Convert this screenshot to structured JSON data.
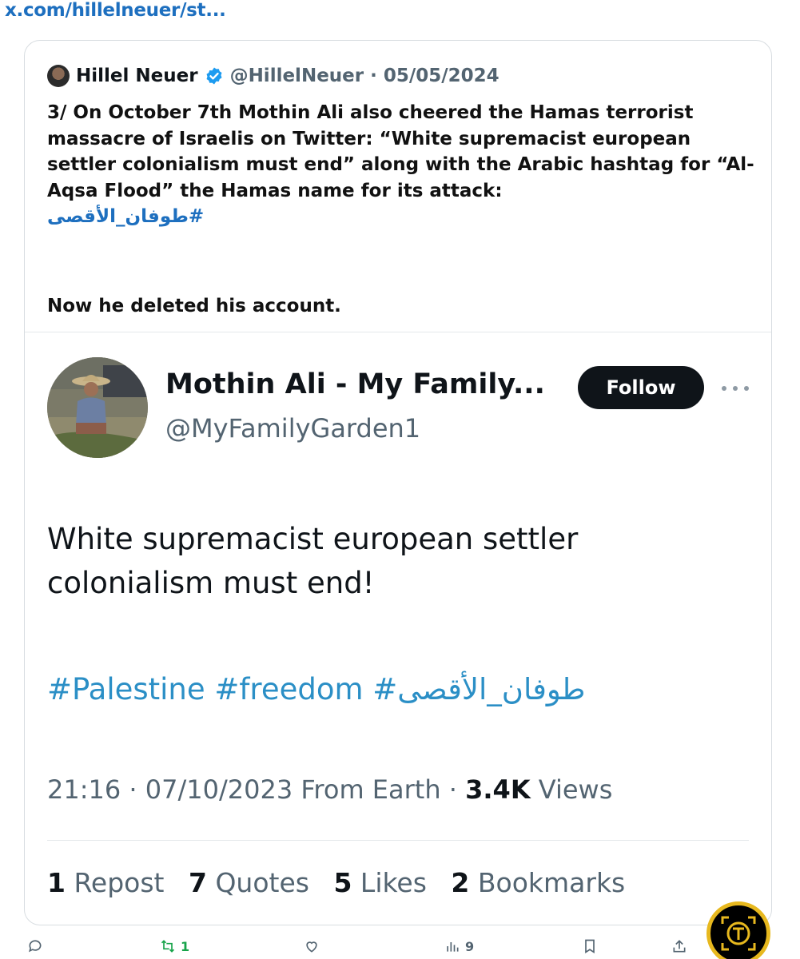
{
  "url": "x.com/hillelneuer/st...",
  "quote": {
    "author_name": "Hillel Neuer",
    "handle_date": "@HillelNeuer · 05/05/2024",
    "text": "3/ On October 7th Mothin Ali also cheered the Hamas terrorist massacre of Israelis on Twitter: “White supremacist european settler colonialism must end” along with the Arabic hashtag for “Al-Aqsa Flood” the Hamas name for its attack:",
    "arabic_hashtag": "#طوفان_الأقصى",
    "after_text": "Now he deleted his account."
  },
  "embedded": {
    "name": "Mothin Ali - My Family...",
    "handle": "@MyFamilyGarden1",
    "follow_label": "Follow",
    "body": "White supremacist european settler colonialism must end!",
    "hashtags": "#Palestine #freedom #طوفان_الأقصى",
    "meta_time": "21:16 · 07/10/2023 From Earth · ",
    "views_count": "3.4K",
    "views_label": " Views",
    "stats": {
      "reposts_n": "1",
      "reposts_label": " Repost",
      "quotes_n": "7",
      "quotes_label": " Quotes",
      "likes_n": "5",
      "likes_label": " Likes",
      "bookmarks_n": "2",
      "bookmarks_label": " Bookmarks"
    }
  },
  "action_bar": {
    "repost_count": "1",
    "views_count": "9"
  },
  "colors": {
    "link_blue": "#1d6fbf",
    "hashtag_blue": "#2b8fc6",
    "follow_bg": "#0f1419",
    "muted": "#536471"
  }
}
